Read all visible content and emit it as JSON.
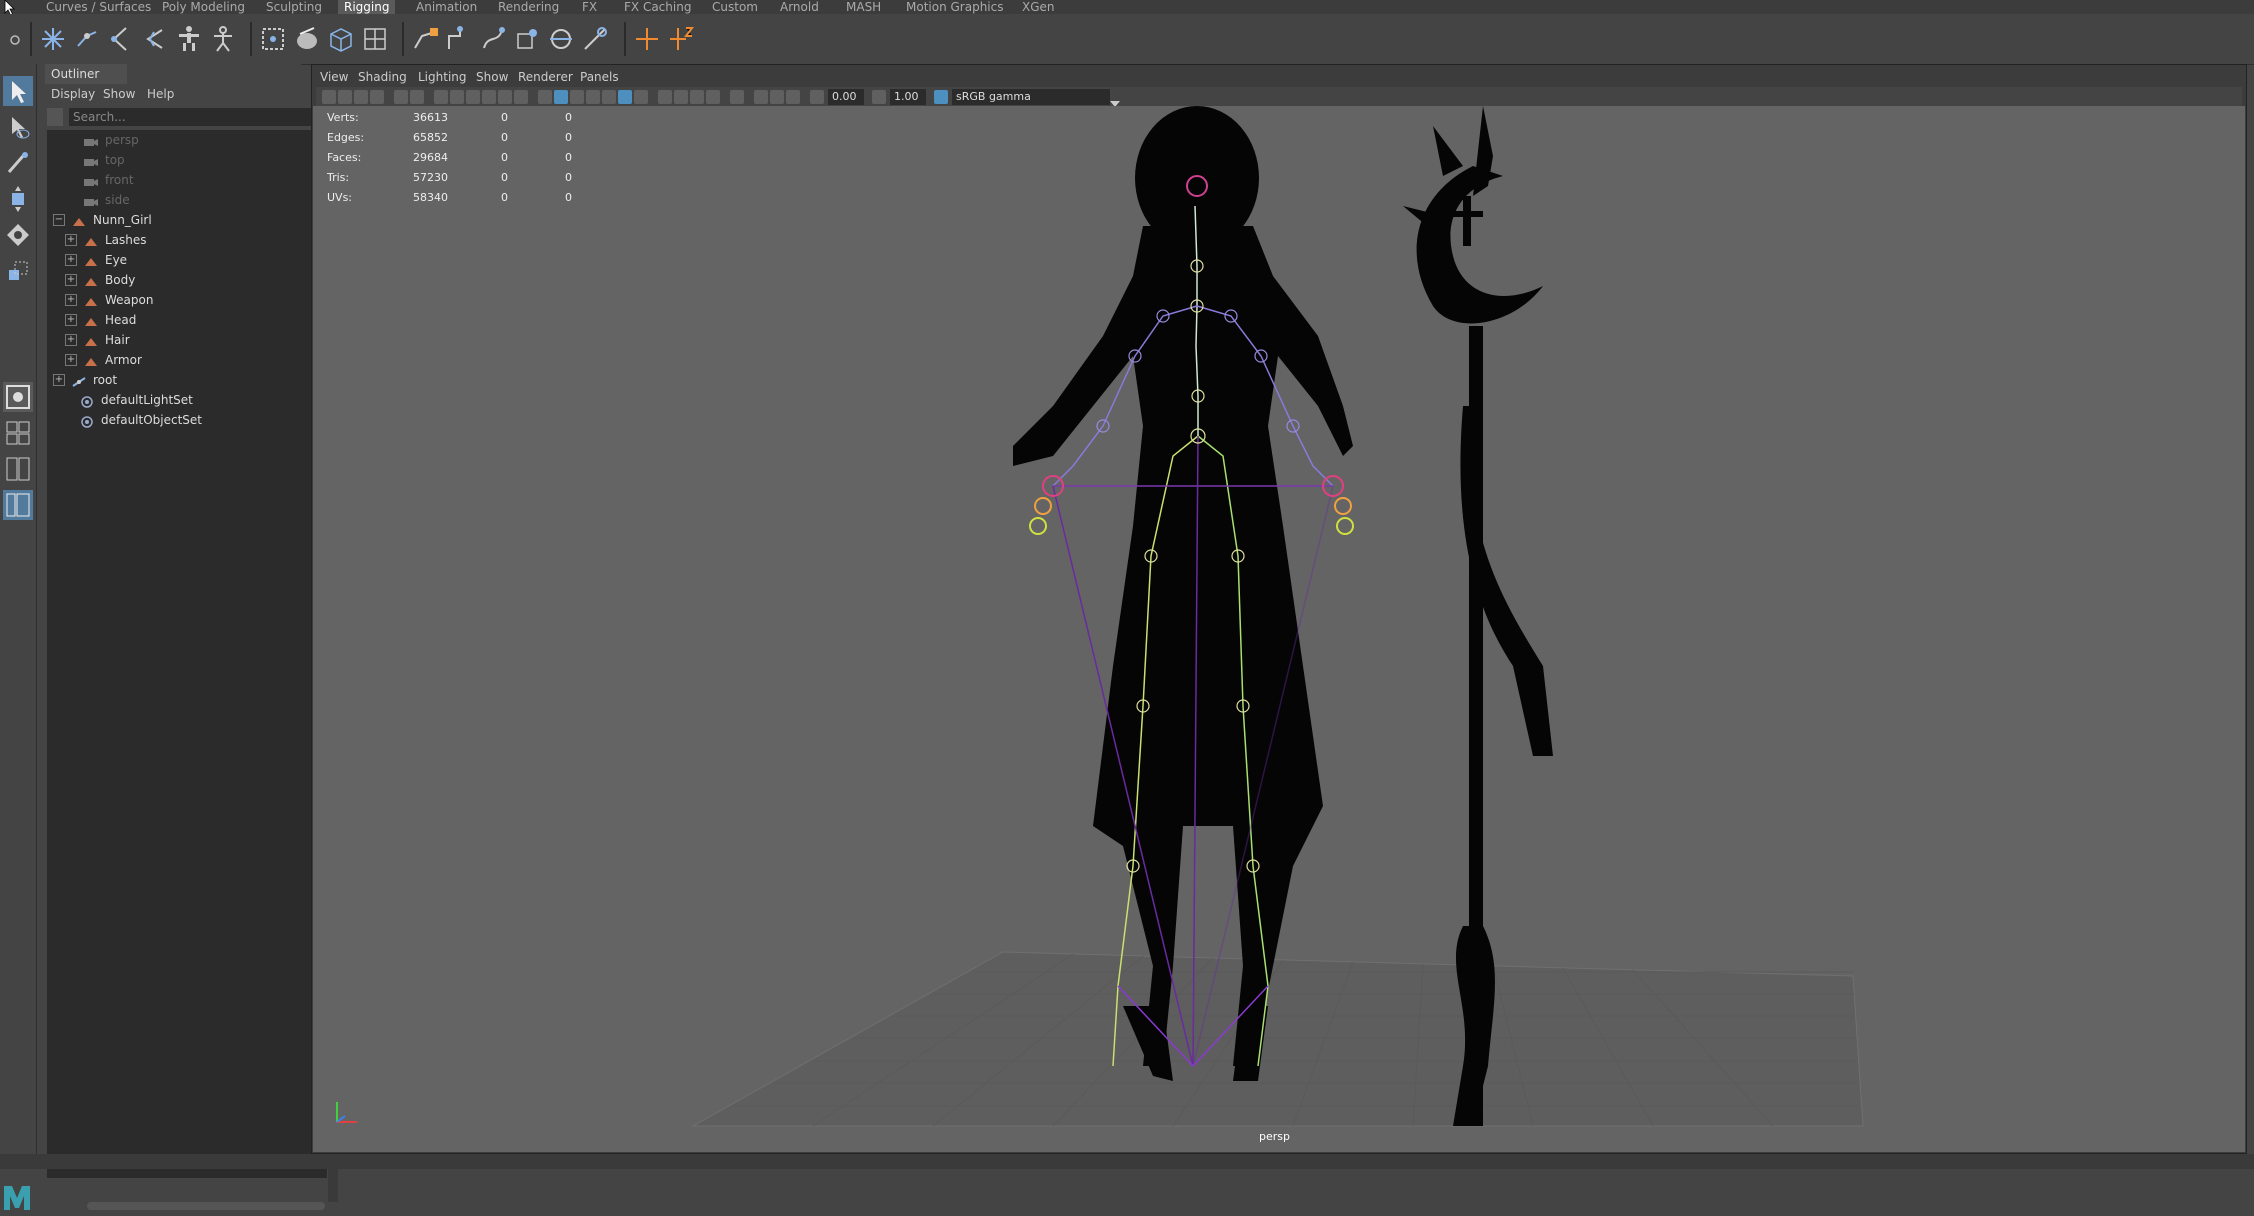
{
  "shelf_tabs": [
    "Curves / Surfaces",
    "Poly Modeling",
    "Sculpting",
    "Rigging",
    "Animation",
    "Rendering",
    "FX",
    "FX Caching",
    "Custom",
    "Arnold",
    "MASH",
    "Motion Graphics",
    "XGen"
  ],
  "active_tab": "Rigging",
  "outliner": {
    "title": "Outliner",
    "menu": [
      "Display",
      "Show",
      "Help"
    ],
    "search_placeholder": "Search...",
    "items": [
      {
        "label": "persp",
        "type": "camera",
        "dim": true,
        "indent": 1
      },
      {
        "label": "top",
        "type": "camera",
        "dim": true,
        "indent": 1
      },
      {
        "label": "front",
        "type": "camera",
        "dim": true,
        "indent": 1
      },
      {
        "label": "side",
        "type": "camera",
        "dim": true,
        "indent": 1
      },
      {
        "label": "Nunn_Girl",
        "type": "mesh",
        "dim": false,
        "indent": 0,
        "expander": "−"
      },
      {
        "label": "Lashes",
        "type": "mesh",
        "dim": false,
        "indent": 1,
        "expander": "+"
      },
      {
        "label": "Eye",
        "type": "mesh",
        "dim": false,
        "indent": 1,
        "expander": "+"
      },
      {
        "label": "Body",
        "type": "mesh",
        "dim": false,
        "indent": 1,
        "expander": "+"
      },
      {
        "label": "Weapon",
        "type": "mesh",
        "dim": false,
        "indent": 1,
        "expander": "+"
      },
      {
        "label": "Head",
        "type": "mesh",
        "dim": false,
        "indent": 1,
        "expander": "+"
      },
      {
        "label": "Hair",
        "type": "mesh",
        "dim": false,
        "indent": 1,
        "expander": "+"
      },
      {
        "label": "Armor",
        "type": "mesh",
        "dim": false,
        "indent": 1,
        "expander": "+"
      },
      {
        "label": "root",
        "type": "joint",
        "dim": false,
        "indent": 0,
        "expander": "+"
      },
      {
        "label": "defaultLightSet",
        "type": "set",
        "dim": false,
        "indent": 0
      },
      {
        "label": "defaultObjectSet",
        "type": "set",
        "dim": false,
        "indent": 0
      }
    ]
  },
  "viewport": {
    "menu": [
      "View",
      "Shading",
      "Lighting",
      "Show",
      "Renderer",
      "Panels"
    ],
    "exposure": "0.00",
    "gamma": "1.00",
    "color_space": "sRGB gamma",
    "camera_label": "persp",
    "hud": [
      {
        "label": "Verts:",
        "value": "36613",
        "sel": "0",
        "comp": "0"
      },
      {
        "label": "Edges:",
        "value": "65852",
        "sel": "0",
        "comp": "0"
      },
      {
        "label": "Faces:",
        "value": "29684",
        "sel": "0",
        "comp": "0"
      },
      {
        "label": "Tris:",
        "value": "57230",
        "sel": "0",
        "comp": "0"
      },
      {
        "label": "UVs:",
        "value": "58340",
        "sel": "0",
        "comp": "0"
      }
    ]
  },
  "colors": {
    "active_tool": "#527a9c",
    "viewport_bg": "#646464",
    "silhouette": "#050505"
  }
}
